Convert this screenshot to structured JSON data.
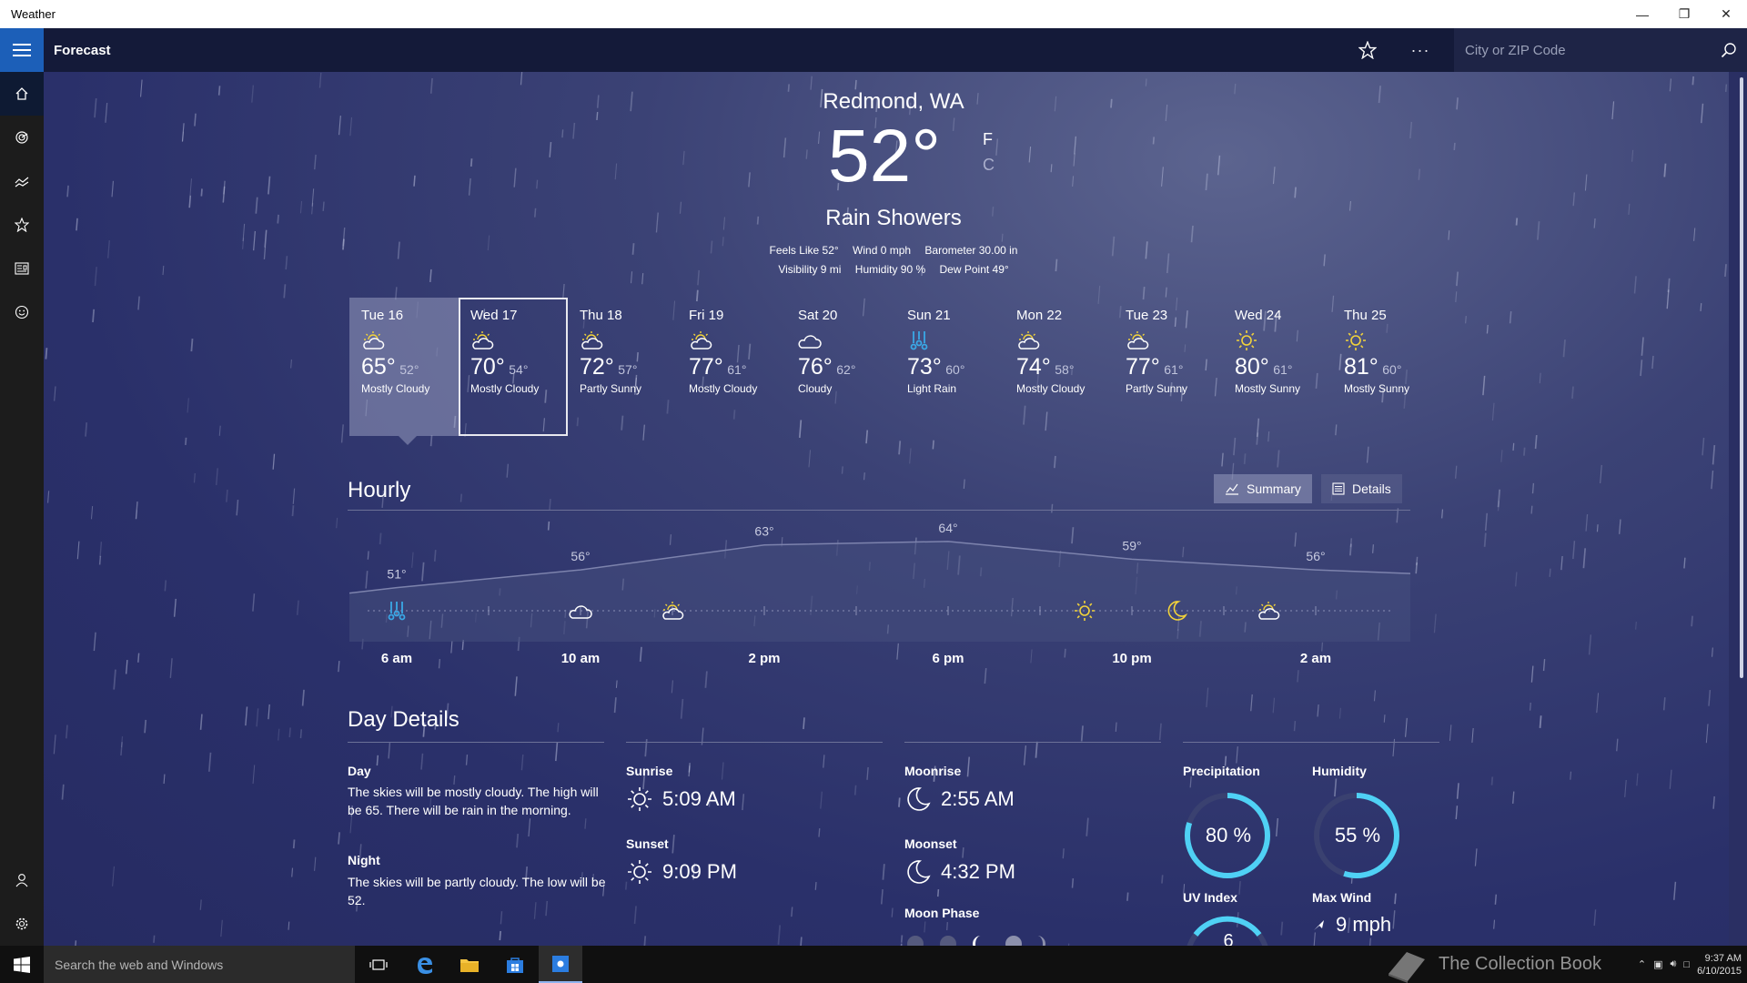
{
  "window": {
    "title": "Weather"
  },
  "appbar": {
    "title": "Forecast",
    "search_placeholder": "City or ZIP Code"
  },
  "current": {
    "city": "Redmond, WA",
    "temp": "52°",
    "unit_f": "F",
    "unit_c": "C",
    "condition": "Rain Showers",
    "stats_row1": [
      "Feels Like  52°",
      "Wind   0 mph",
      "Barometer  30.00 in"
    ],
    "stats_row2": [
      "Visibility  9 mi",
      "Humidity  90 %",
      "Dew Point  49°"
    ]
  },
  "forecast": [
    {
      "day": "Tue 16",
      "hi": "65°",
      "lo": "52°",
      "cond": "Mostly Cloudy",
      "icon": "partly-cloudy-icon"
    },
    {
      "day": "Wed 17",
      "hi": "70°",
      "lo": "54°",
      "cond": "Mostly Cloudy",
      "icon": "partly-cloudy-icon"
    },
    {
      "day": "Thu 18",
      "hi": "72°",
      "lo": "57°",
      "cond": "Partly Sunny",
      "icon": "partly-cloudy-icon"
    },
    {
      "day": "Fri 19",
      "hi": "77°",
      "lo": "61°",
      "cond": "Mostly Cloudy",
      "icon": "partly-cloudy-icon"
    },
    {
      "day": "Sat 20",
      "hi": "76°",
      "lo": "62°",
      "cond": "Cloudy",
      "icon": "cloud-icon"
    },
    {
      "day": "Sun 21",
      "hi": "73°",
      "lo": "60°",
      "cond": "Light Rain",
      "icon": "rain-icon"
    },
    {
      "day": "Mon 22",
      "hi": "74°",
      "lo": "58°",
      "cond": "Mostly Cloudy",
      "icon": "partly-cloudy-icon"
    },
    {
      "day": "Tue 23",
      "hi": "77°",
      "lo": "61°",
      "cond": "Partly Sunny",
      "icon": "partly-cloudy-icon"
    },
    {
      "day": "Wed 24",
      "hi": "80°",
      "lo": "61°",
      "cond": "Mostly Sunny",
      "icon": "sun-icon"
    },
    {
      "day": "Thu 25",
      "hi": "81°",
      "lo": "60°",
      "cond": "Mostly Sunny",
      "icon": "sun-icon"
    }
  ],
  "hourly": {
    "title": "Hourly",
    "tab_summary": "Summary",
    "tab_details": "Details",
    "time_labels": [
      "6 am",
      "10 am",
      "2 pm",
      "6 pm",
      "10 pm",
      "2 am"
    ],
    "temp_labels": [
      "51°",
      "56°",
      "63°",
      "64°",
      "59°",
      "56°"
    ],
    "temp_values": [
      51,
      56,
      63,
      64,
      59,
      56
    ],
    "icons": [
      "rain-icon",
      "cloud-icon",
      "partly-cloudy-icon",
      "sun-icon",
      "moon-icon",
      "partly-cloudy-icon"
    ]
  },
  "day_details": {
    "title": "Day Details",
    "day_label": "Day",
    "day_text": "The skies will be mostly cloudy. The high will be 65. There will be rain in the morning.",
    "night_label": "Night",
    "night_text": "The skies will be partly cloudy. The low will be 52.",
    "sunrise_label": "Sunrise",
    "sunrise": "5:09 AM",
    "sunset_label": "Sunset",
    "sunset": "9:09 PM",
    "moonrise_label": "Moonrise",
    "moonrise": "2:55 AM",
    "moonset_label": "Moonset",
    "moonset": "4:32 PM",
    "moonphase_label": "Moon Phase",
    "precip_label": "Precipitation",
    "precip": "80 %",
    "precip_fraction": 0.8,
    "humidity_label": "Humidity",
    "humidity": "55 %",
    "humidity_fraction": 0.55,
    "uv_label": "UV Index",
    "uv": "6",
    "wind_label": "Max Wind",
    "wind": "9 mph"
  },
  "taskbar": {
    "search_placeholder": "Search the web and Windows",
    "time": "9:37 AM",
    "date": "6/10/2015",
    "watermark": "The Collection Book"
  },
  "colors": {
    "accent": "#4fd1f5",
    "rain": "#3aa8e6",
    "sun": "#f2d33a"
  }
}
